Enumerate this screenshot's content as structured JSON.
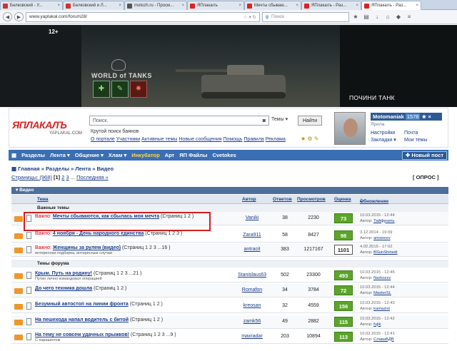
{
  "browser": {
    "tabs": [
      {
        "label": "Белковский - У...",
        "icon": "youtube-icon"
      },
      {
        "label": "Белковский и Л...",
        "icon": "youtube-icon"
      },
      {
        "label": "motozh.ru - Просм...",
        "icon": "site-icon"
      },
      {
        "label": "ЯПлакалъ",
        "icon": "yaplakal-icon"
      },
      {
        "label": "Мечты сбываю...",
        "icon": "yaplakal-icon"
      },
      {
        "label": "ЯПлакалъ - Раз...",
        "icon": "yaplakal-icon"
      },
      {
        "label": "ЯПлакалъ - Раз...",
        "icon": "yaplakal-icon"
      }
    ],
    "url": "www.yaplakal.com/forum28/",
    "search_placeholder": "Поиск"
  },
  "banner": {
    "age": "12+",
    "logo": "WORLD of TANKS",
    "cta": "ПОЧИНИ ТАНК"
  },
  "header": {
    "logo": "ЯПЛАКАЛЪ",
    "logo_sub": "YAPLAKAL.COM",
    "search_value": "Поиск.",
    "search_scope": "Темы",
    "find_button": "Найти",
    "tagline": "Крутой поиск баянов",
    "links": [
      "О портале",
      "Участники",
      "Активные темы",
      "Новые сообщения",
      "Помощь",
      "Правила",
      "Реклама"
    ]
  },
  "user": {
    "name": "Motomaniak",
    "count": "1578",
    "rank": "Ярила",
    "links_left": [
      "Настройки",
      "Закладки"
    ],
    "links_right": [
      "Почта",
      "Мои темы"
    ]
  },
  "menu": {
    "items": [
      "Разделы",
      "Лента",
      "Общение",
      "Хлам",
      "Инкубатор",
      "Арт",
      "ЯП Файлы",
      "Cvetokes"
    ],
    "new_post": "Новый пост"
  },
  "breadcrumb": "Главная » Разделы » Лента » Видео",
  "pages": {
    "label": "Страницы: (968)",
    "current": "[1]",
    "others": [
      "2",
      "3"
    ],
    "last": "Последняя »"
  },
  "poll_button": "[ ОПРОС ]",
  "section": "Видео",
  "columns": {
    "topic": "Тема",
    "author": "Автор",
    "replies": "Ответов",
    "views": "Просмотров",
    "rating": "Оценка",
    "updated": "Обновление"
  },
  "groups": {
    "important": "Важные темы",
    "forum": "Темы форума"
  },
  "important_label": "Важно:",
  "rows": [
    {
      "important": true,
      "title": "Мечты сбываются, как сбылась моя мечта",
      "pages": "(Страниц 1 2 )",
      "sub": "",
      "author": "Vaniki",
      "replies": "38",
      "views": "2230",
      "rating": "73",
      "updated": "10.03.2015 - 12:44",
      "last_author": "Тайфунить"
    },
    {
      "important": true,
      "title": "4 ноября - День народного единства",
      "pages": "(Страниц 1 2 3 )",
      "sub": "",
      "author": "Zara911",
      "replies": "58",
      "views": "8427",
      "rating": "98",
      "updated": "3.12.2014 - 19:09",
      "last_author": "amseeev"
    },
    {
      "important": true,
      "title": "Женщины за рулем (видео)",
      "pages": "(Страниц 1 2 3 ...16 )",
      "sub": "интересная подборка, интересные случаи",
      "author": "antracit",
      "replies": "383",
      "views": "1217167",
      "rating": "1101",
      "updated": "4.02.2015 - 17:02",
      "last_author": "BSunShinedi"
    },
    {
      "important": false,
      "title": "Крым. Путь на родину!",
      "pages": "(Страниц 1 2 3 ...21 )",
      "sub": "Путин лично командовал операцией",
      "author": "Stanislaus63",
      "replies": "502",
      "views": "23300",
      "rating": "493",
      "updated": "10.03.2015 - 12:45",
      "last_author": "Narkozzz"
    },
    {
      "important": false,
      "title": "До чего техника дошла",
      "pages": "(Страниц 1 2 )",
      "sub": "",
      "author": "Romafon",
      "replies": "34",
      "views": "3784",
      "rating": "72",
      "updated": "10.03.2015 - 12:44",
      "last_author": "MasterSL"
    },
    {
      "important": false,
      "title": "Безумный автостоп на линии фронта",
      "pages": "(Страниц 1 2 )",
      "sub": "",
      "author": "kreosan",
      "replies": "32",
      "views": "4559",
      "rating": "156",
      "updated": "10.03.2015 - 12:43",
      "last_author": "kamazist"
    },
    {
      "important": false,
      "title": "На пешехода напал водитель с битой",
      "pages": "(Страниц 1 2 )",
      "sub": "",
      "author": "zamk56",
      "replies": "49",
      "views": "2882",
      "rating": "115",
      "updated": "10.03.2015 - 12:42",
      "last_author": "fujik"
    },
    {
      "important": false,
      "title": "На тему не совсем удачных прыжков!",
      "pages": "(Страниц 1 2 3 ...9 )",
      "sub": "С парашютом",
      "author": "maxradar",
      "replies": "203",
      "views": "10894",
      "rating": "113",
      "updated": "10.03.2015 - 12:41",
      "last_author": "СлаваВДВ"
    }
  ],
  "last_label": "Автор:",
  "colors": {
    "accent": "#3a6fb5",
    "rating_green": "#5aa52a",
    "highlight": "#d01f1f"
  }
}
